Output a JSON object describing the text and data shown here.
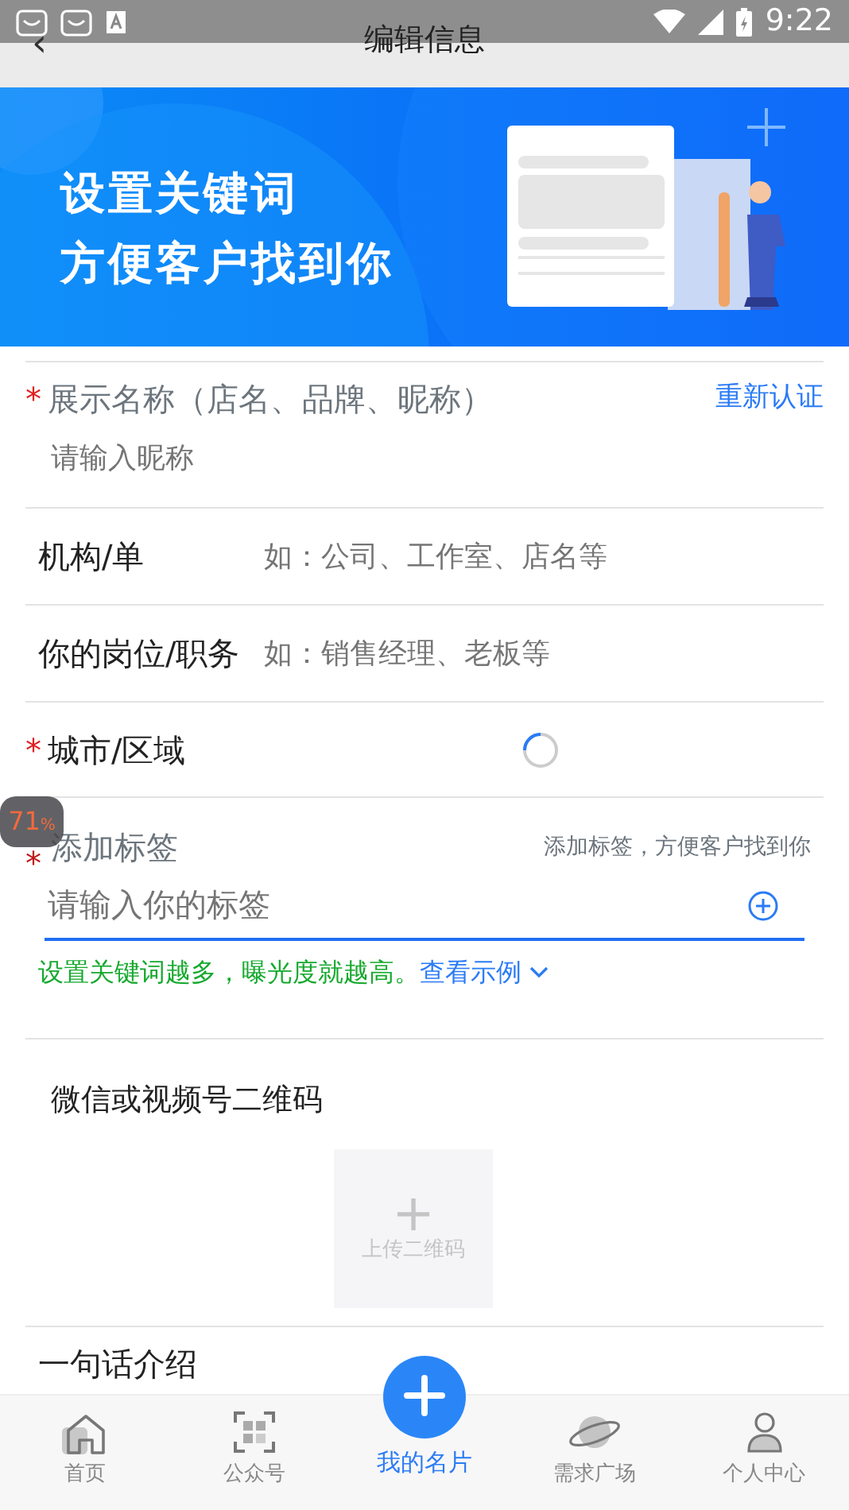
{
  "status_bar": {
    "time": "9:22"
  },
  "header": {
    "back": "‹",
    "title": "编辑信息"
  },
  "banner": {
    "kind": "picture",
    "lines": [
      "设置关键词",
      "方便客户找到你"
    ]
  },
  "required_mark": "*",
  "fields": [
    {
      "kind": "stacked",
      "required": true,
      "label": "展示名称（店名、品牌、昵称）",
      "action": "重新认证",
      "placeholder": "请输入昵称"
    },
    {
      "kind": "inline",
      "required": false,
      "label": "机构/单",
      "placeholder": "如：公司、工作室、店名等"
    },
    {
      "kind": "inline",
      "required": false,
      "label": "你的岗位/职务",
      "placeholder": "如：销售经理、老板等"
    },
    {
      "kind": "loading",
      "required": true,
      "label": "城市/区域"
    }
  ],
  "tags": {
    "required": true,
    "label": "添加标签",
    "note": "添加标签，方便客户找到你",
    "placeholder": "请输入你的标签",
    "focused": true,
    "hint": "设置关键词越多，曝光度就越高。",
    "link": "查看示例"
  },
  "qr": {
    "title": "微信或视频号二维码",
    "upload_icon": "+",
    "upload_label": "上传二维码"
  },
  "intro": {
    "title": "一句话介绍"
  },
  "overlay_badge": {
    "value": "71",
    "unit": "%"
  },
  "tabbar": [
    {
      "kind": "home",
      "label": "首页",
      "selected": false
    },
    {
      "kind": "qr",
      "label": "公众号",
      "selected": false
    },
    {
      "kind": "plus",
      "label": "我的名片",
      "selected": true
    },
    {
      "kind": "planet",
      "label": "需求广场",
      "selected": false
    },
    {
      "kind": "person",
      "label": "个人中心",
      "selected": false
    }
  ]
}
